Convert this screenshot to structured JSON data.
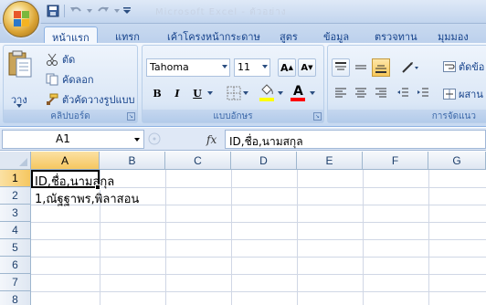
{
  "title_bar": {
    "title": "Microsoft Excel - ตัวอย่าง"
  },
  "tabs": [
    {
      "label": "หน้าแรก"
    },
    {
      "label": "แทรก"
    },
    {
      "label": "เค้าโครงหน้ากระดาษ"
    },
    {
      "label": "สูตร"
    },
    {
      "label": "ข้อมูล"
    },
    {
      "label": "ตรวจทาน"
    },
    {
      "label": "มุมมอง"
    }
  ],
  "clipboard": {
    "paste_label": "วาง",
    "cut_label": "ตัด",
    "copy_label": "คัดลอก",
    "format_painter_label": "ตัวคัดวางรูปแบบ",
    "group_label": "คลิปบอร์ด"
  },
  "font": {
    "font_name": "Tahoma",
    "font_size": "11",
    "group_label": "แบบอักษร",
    "bold": "B",
    "italic": "I",
    "underline": "U",
    "grow": "A",
    "shrink": "A",
    "font_color_letter": "A",
    "fill_color": "#ffff00",
    "font_color": "#ff0000"
  },
  "alignment": {
    "group_label": "การจัดแนว",
    "wrap_label": "ตัดข้อ",
    "merge_label": "ผสาน"
  },
  "formula_bar": {
    "cell_ref": "A1",
    "fx": "fx",
    "content": "ID,ชื่อ,นามสกุล"
  },
  "sheet": {
    "columns": [
      "A",
      "B",
      "C",
      "D",
      "E",
      "F",
      "G"
    ],
    "rows": [
      "1",
      "2",
      "3",
      "4",
      "5",
      "6",
      "7",
      "8"
    ],
    "cells": {
      "A1": "ID,ชื่อ,นามสกุล",
      "A2": "1,ณัฐฐาพร,พิลาสอน"
    },
    "active_cell": "A1"
  }
}
